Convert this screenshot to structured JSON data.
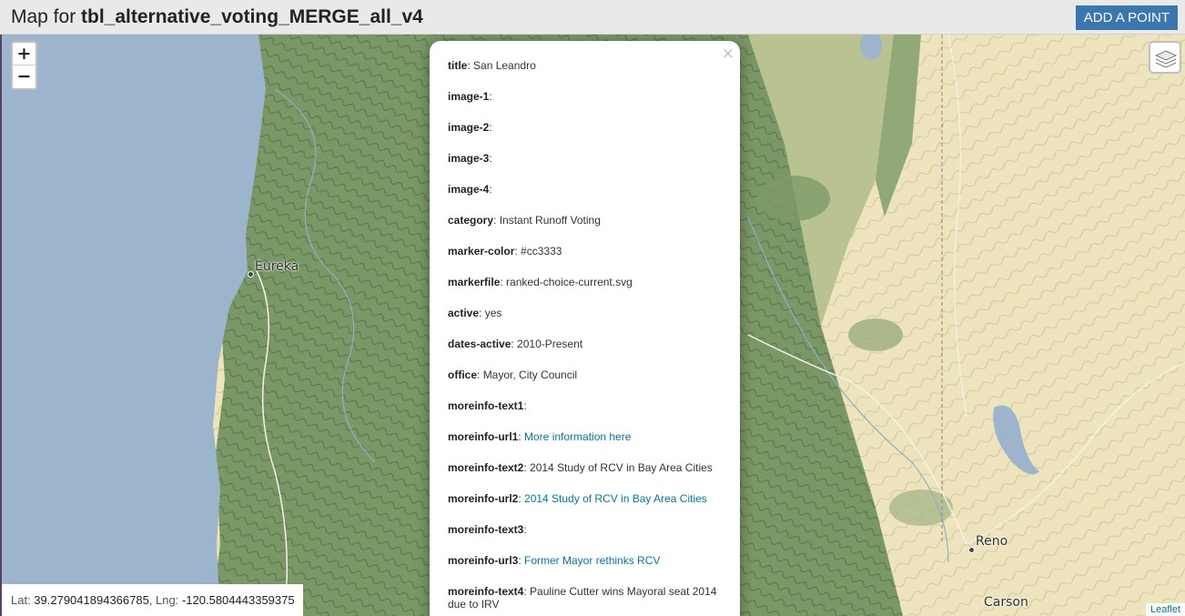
{
  "header": {
    "title_prefix": "Map for ",
    "table_name": "tbl_alternative_voting_MERGE_all_v4",
    "add_point_label": "ADD A POINT"
  },
  "map": {
    "zoom_in": "+",
    "zoom_out": "−",
    "layers_icon": "layers-icon",
    "cities": {
      "eureka": "Eureka",
      "reno": "Reno",
      "carson": "Carson"
    },
    "coords": {
      "lat_label": "Lat: ",
      "lat": "39.279041894366785",
      "lng_label": ", Lng: ",
      "lng": "-120.5804443359375"
    },
    "attribution": "Leaflet"
  },
  "popup": {
    "close": "×",
    "fields": [
      {
        "key": "title",
        "value": "San Leandro"
      },
      {
        "key": "image-1",
        "value": ""
      },
      {
        "key": "image-2",
        "value": ""
      },
      {
        "key": "image-3",
        "value": ""
      },
      {
        "key": "image-4",
        "value": ""
      },
      {
        "key": "category",
        "value": "Instant Runoff Voting"
      },
      {
        "key": "marker-color",
        "value": "#cc3333"
      },
      {
        "key": "markerfile",
        "value": "ranked-choice-current.svg"
      },
      {
        "key": "active",
        "value": "yes"
      },
      {
        "key": "dates-active",
        "value": "2010-Present"
      },
      {
        "key": "office",
        "value": "Mayor, City Council"
      },
      {
        "key": "moreinfo-text1",
        "value": ""
      },
      {
        "key": "moreinfo-url1",
        "value": "More information here"
      },
      {
        "key": "moreinfo-text2",
        "value": "2014 Study of RCV in Bay Area Cities"
      },
      {
        "key": "moreinfo-url2",
        "value": "2014 Study of RCV in Bay Area Cities"
      },
      {
        "key": "moreinfo-text3",
        "value": ""
      },
      {
        "key": "moreinfo-url3",
        "value": "Former Mayor rethinks RCV"
      },
      {
        "key": "moreinfo-text4",
        "value": "Pauline Cutter wins Mayoral seat 2014 due to IRV"
      }
    ]
  },
  "colors": {
    "header_bg": "#e9e9e9",
    "button_bg": "#3a77b0",
    "link": "#0078a8",
    "ocean": "#9db5cc",
    "forest": "#6f8c5e",
    "desert": "#ede4bd"
  }
}
